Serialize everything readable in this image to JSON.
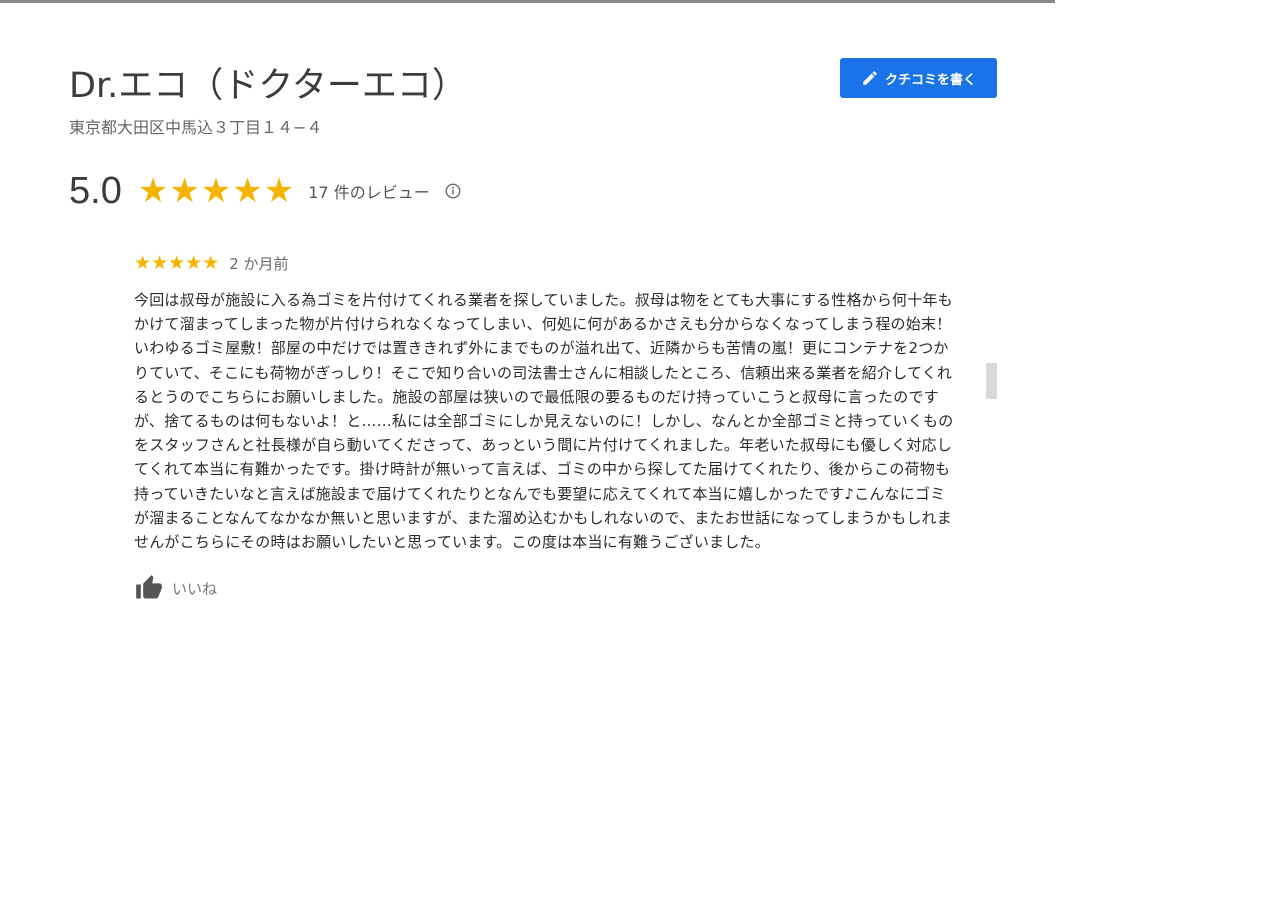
{
  "business": {
    "name": "Dr.エコ（ドクターエコ）",
    "address": "東京都大田区中馬込３丁目１４−４"
  },
  "actions": {
    "write_review_label": "クチコミを書く",
    "write_review_icon": "pencil-icon"
  },
  "rating": {
    "value": "5.0",
    "stars": 5,
    "review_count_label": "17 件のレビュー",
    "info_icon": "info-icon"
  },
  "review": {
    "stars": 5,
    "date": "2 か月前",
    "text": "今回は叔母が施設に入る為ゴミを片付けてくれる業者を探していました。叔母は物をとても大事にする性格から何十年もかけて溜まってしまった物が片付けられなくなってしまい、何処に何があるかさえも分からなくなってしまう程の始末！いわゆるゴミ屋敷！部屋の中だけでは置ききれず外にまでものが溢れ出て、近隣からも苦情の嵐！更にコンテナを2つかりていて、そこにも荷物がぎっしり！そこで知り合いの司法書士さんに相談したところ、信頼出来る業者を紹介してくれるとうのでこちらにお願いしました。施設の部屋は狭いので最低限の要るものだけ持っていこうと叔母に言ったのですが、捨てるものは何もないよ！と……私には全部ゴミにしか見えないのに！しかし、なんとか全部ゴミと持っていくものをスタッフさんと社長様が自ら動いてくださって、あっという間に片付けてくれました。年老いた叔母にも優しく対応してくれて本当に有難かったです。掛け時計が無いって言えば、ゴミの中から探してた届けてくれたり、後からこの荷物も持っていきたいなと言えば施設まで届けてくれたりとなんでも要望に応えてくれて本当に嬉しかったです♪こんなにゴミが溜まることなんてなかなか無いと思いますが、また溜め込むかもしれないので、またお世話になってしまうかもしれませんがこちらにその時はお願いしたいと思っています。この度は本当に有難うございました。",
    "like_label": "いいね",
    "like_icon": "thumbs-up-icon"
  },
  "colors": {
    "accent": "#1a73e8",
    "star": "#f4b400",
    "title": "#3c3c3c",
    "muted": "#666666"
  }
}
